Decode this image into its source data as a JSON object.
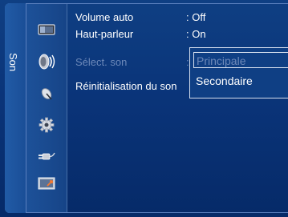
{
  "sidebar": {
    "title": "Son"
  },
  "icons": [
    "picture-icon",
    "sound-icon",
    "channel-icon",
    "setup-icon",
    "input-icon",
    "application-icon"
  ],
  "menu": {
    "items": [
      {
        "label": "Volume auto",
        "value": ": Off"
      },
      {
        "label": "Haut-parleur",
        "value": ": On"
      },
      {
        "label": "Sélect. son",
        "value": ":"
      },
      {
        "label": "Réinitialisation du son",
        "value": ""
      }
    ]
  },
  "popup": {
    "options": [
      "Principale",
      "Secondaire"
    ],
    "selected": "Principale"
  },
  "colors": {
    "background": "#0a3479",
    "text": "#ffffff",
    "dimmed": "#6d89b9",
    "border": "#d6dfee"
  }
}
